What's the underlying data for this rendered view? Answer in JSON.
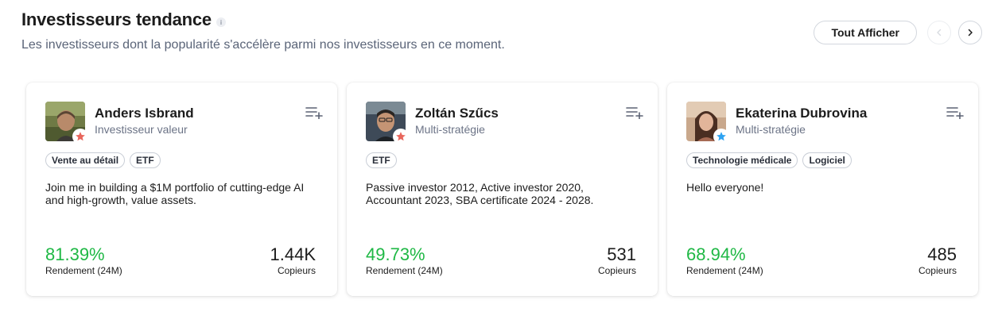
{
  "header": {
    "title": "Investisseurs tendance",
    "info_icon": "i",
    "subtitle": "Les investisseurs dont la popularité s'accélère parmi nos investisseurs en ce moment.",
    "show_all_label": "Tout Afficher"
  },
  "colors": {
    "gain": "#1fb845",
    "star_red": "#e8665c",
    "star_blue": "#2ea3f2",
    "border": "#d3d7de"
  },
  "cards": [
    {
      "name": "Anders Isbrand",
      "style": "Investisseur valeur",
      "badge": "star-red",
      "tags": [
        "Vente au détail",
        "ETF"
      ],
      "bio": "Join me in building a $1M portfolio of cutting-edge AI and high-growth, value assets.",
      "gain": "81.39%",
      "gain_label": "Rendement (24M)",
      "copiers": "1.44K",
      "copiers_label": "Copieurs"
    },
    {
      "name": "Zoltán Szűcs",
      "style": "Multi-stratégie",
      "badge": "star-red",
      "tags": [
        "ETF"
      ],
      "bio": "Passive investor 2012, Active investor 2020, Accountant 2023, SBA certificate 2024 - 2028.",
      "gain": "49.73%",
      "gain_label": "Rendement (24M)",
      "copiers": "531",
      "copiers_label": "Copieurs"
    },
    {
      "name": "Ekaterina Dubrovina",
      "style": "Multi-stratégie",
      "badge": "star-blue",
      "tags": [
        "Technologie médicale",
        "Logiciel"
      ],
      "bio": "Hello everyone!",
      "gain": "68.94%",
      "gain_label": "Rendement (24M)",
      "copiers": "485",
      "copiers_label": "Copieurs"
    }
  ]
}
